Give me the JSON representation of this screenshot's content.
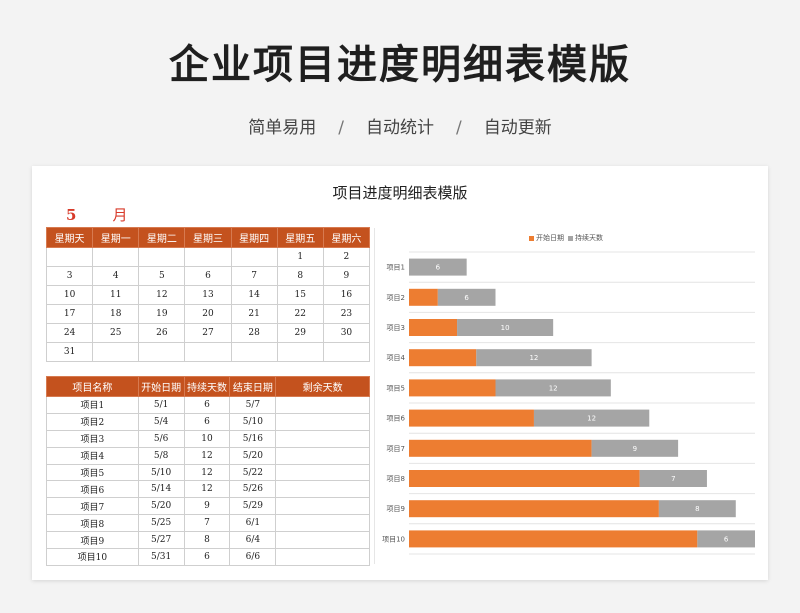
{
  "header": {
    "title": "企业项目进度明细表模版",
    "subtitle_parts": [
      "简单易用",
      "自动统计",
      "自动更新"
    ],
    "separator": "/"
  },
  "sheet": {
    "title": "项目进度明细表模版",
    "month_value": "5",
    "month_unit": "月"
  },
  "calendar": {
    "weekdays": [
      "星期天",
      "星期一",
      "星期二",
      "星期三",
      "星期四",
      "星期五",
      "星期六"
    ],
    "weeks": [
      [
        "",
        "",
        "",
        "",
        "",
        "1",
        "2"
      ],
      [
        "3",
        "4",
        "5",
        "6",
        "7",
        "8",
        "9"
      ],
      [
        "10",
        "11",
        "12",
        "13",
        "14",
        "15",
        "16"
      ],
      [
        "17",
        "18",
        "19",
        "20",
        "21",
        "22",
        "23"
      ],
      [
        "24",
        "25",
        "26",
        "27",
        "28",
        "29",
        "30"
      ],
      [
        "31",
        "",
        "",
        "",
        "",
        "",
        ""
      ]
    ]
  },
  "projects": {
    "headers": [
      "项目名称",
      "开始日期",
      "持续天数",
      "结束日期",
      "剩余天数"
    ],
    "rows": [
      [
        "项目1",
        "5/1",
        "6",
        "5/7",
        ""
      ],
      [
        "项目2",
        "5/4",
        "6",
        "5/10",
        ""
      ],
      [
        "项目3",
        "5/6",
        "10",
        "5/16",
        ""
      ],
      [
        "项目4",
        "5/8",
        "12",
        "5/20",
        ""
      ],
      [
        "项目5",
        "5/10",
        "12",
        "5/22",
        ""
      ],
      [
        "项目6",
        "5/14",
        "12",
        "5/26",
        ""
      ],
      [
        "项目7",
        "5/20",
        "9",
        "5/29",
        ""
      ],
      [
        "项目8",
        "5/25",
        "7",
        "6/1",
        ""
      ],
      [
        "项目9",
        "5/27",
        "8",
        "6/4",
        ""
      ],
      [
        "项目10",
        "5/31",
        "6",
        "6/6",
        ""
      ]
    ]
  },
  "chart_data": {
    "type": "bar",
    "orientation": "horizontal-stacked",
    "categories": [
      "项目1",
      "项目2",
      "项目3",
      "项目4",
      "项目5",
      "项目6",
      "项目7",
      "项目8",
      "项目9",
      "项目10"
    ],
    "series": [
      {
        "name": "开始日期",
        "values": [
          1,
          4,
          6,
          8,
          10,
          14,
          20,
          25,
          27,
          31
        ],
        "color": "#ed7d31"
      },
      {
        "name": "持续天数",
        "values": [
          6,
          6,
          10,
          12,
          12,
          12,
          9,
          7,
          8,
          6
        ],
        "color": "#a5a5a5"
      }
    ],
    "data_labels_series": "持续天数",
    "xlim": [
      1,
      37
    ],
    "grid": true,
    "legend": "top-center"
  }
}
